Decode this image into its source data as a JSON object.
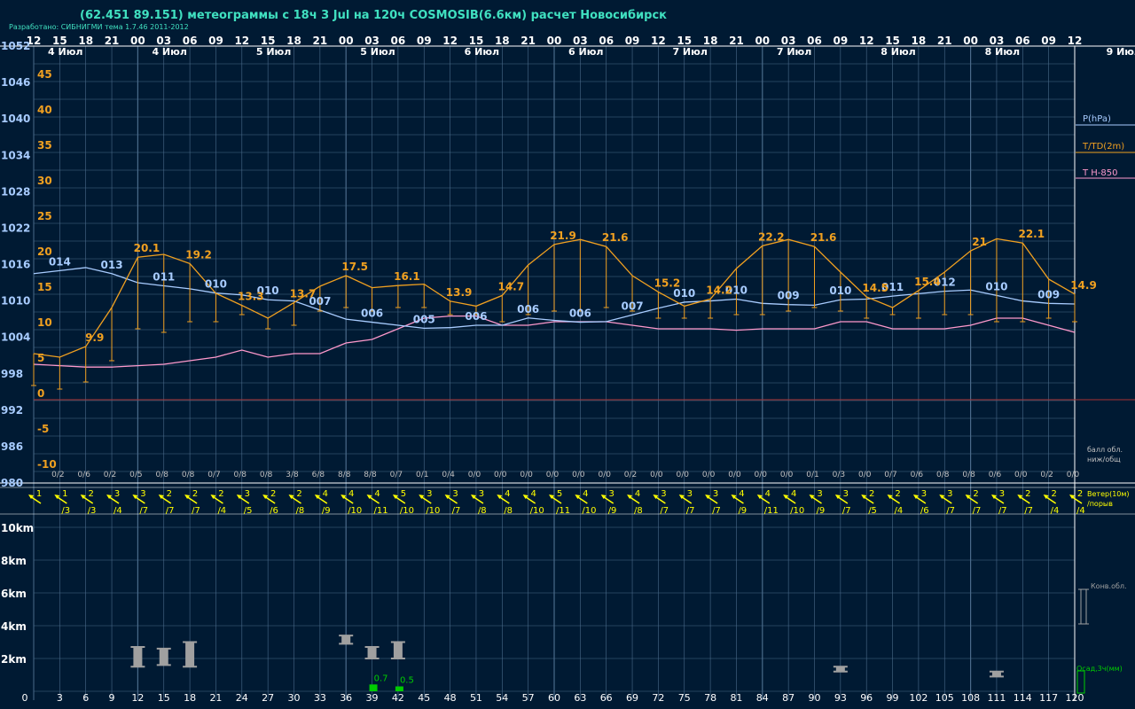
{
  "header": {
    "title": "(62.451 89.151) метеограммы с  18ч 3 Jul на 120ч COSMOSIB(6.6км) расчет Новосибирск",
    "subtitle": "Разработано: СИБНИГМИ тема 1.7.46 2011-2012"
  },
  "colors": {
    "background": "#001a33",
    "grid": "#4a6a8a",
    "pressure": "#a8ccff",
    "temperature": "#f0a020",
    "t850": "#ff99cc",
    "wind": "#ffff00",
    "precip": "#00cc00",
    "cloud": "#a0a0a0",
    "zero_line": "#aa3333",
    "hour_text": "#ffffff",
    "clouds_text": "#c0c0c0"
  },
  "legend": {
    "pressure": "P(hPa)",
    "temperature": "T/TD(2m)",
    "t850": "T H-850",
    "clouds": "балл обл.",
    "clouds2": "ниж/общ",
    "wind": "Ветер(10м)",
    "wind2": "/порыв",
    "conv": "Конв.обл.",
    "precip": "Осад,3ч(мм)"
  },
  "chart_data": {
    "type": "line",
    "time_hours": [
      0,
      3,
      6,
      9,
      12,
      15,
      18,
      21,
      24,
      27,
      30,
      33,
      36,
      39,
      42,
      45,
      48,
      51,
      54,
      57,
      60,
      63,
      66,
      69,
      72,
      75,
      78,
      81,
      84,
      87,
      90,
      93,
      96,
      99,
      102,
      105,
      108,
      111,
      114,
      117,
      120
    ],
    "hour_labels": [
      "12",
      "15",
      "18",
      "21",
      "00",
      "03",
      "06",
      "09",
      "12",
      "15",
      "18",
      "21",
      "00",
      "03",
      "06",
      "09",
      "12",
      "15",
      "18",
      "21",
      "00",
      "03",
      "06",
      "09",
      "12",
      "15",
      "18",
      "21",
      "00",
      "03",
      "06",
      "09",
      "12",
      "15",
      "18",
      "21",
      "00",
      "03",
      "06",
      "09",
      "12"
    ],
    "day_labels": [
      {
        "label": "4 Июл",
        "hour": 1
      },
      {
        "label": "4 Июл",
        "hour": 13
      },
      {
        "label": "5 Июл",
        "hour": 25
      },
      {
        "label": "5 Июл",
        "hour": 37
      },
      {
        "label": "6 Июл",
        "hour": 49
      },
      {
        "label": "6 Июл",
        "hour": 61
      },
      {
        "label": "7 Июл",
        "hour": 73
      },
      {
        "label": "7 Июл",
        "hour": 85
      },
      {
        "label": "8 Июл",
        "hour": 97
      },
      {
        "label": "8 Июл",
        "hour": 109
      },
      {
        "label": "9 Июл",
        "hour": 123
      }
    ],
    "pressure_axis": {
      "ticks": [
        "1052",
        "1046",
        "1040",
        "1034",
        "1028",
        "1022",
        "1016",
        "1010",
        "1004",
        "998",
        "992",
        "986",
        "980"
      ],
      "min": 980,
      "max": 1052
    },
    "temp_axis": {
      "ticks": [
        "45",
        "40",
        "35",
        "30",
        "25",
        "20",
        "15",
        "10",
        "5",
        "0",
        "-5",
        "-10"
      ],
      "min": -10,
      "max": 45
    },
    "pressure": [
      1014.5,
      1015,
      1015.5,
      1014.5,
      1013,
      1012.5,
      1012,
      1011.3,
      1011,
      1010.2,
      1010,
      1008.5,
      1007,
      1006.5,
      1006,
      1005.5,
      1005.6,
      1006,
      1006,
      1007.2,
      1006.8,
      1006.5,
      1006.6,
      1007.7,
      1008.8,
      1009.8,
      1010,
      1010.3,
      1009.6,
      1009.4,
      1009.3,
      1010.2,
      1010.3,
      1010.8,
      1011.2,
      1011.6,
      1011.8,
      1010.9,
      1010,
      1009.6,
      1009.5
    ],
    "temperature": [
      6.5,
      6,
      7.5,
      13,
      20.1,
      20.5,
      19.2,
      15,
      13.3,
      11.5,
      13.7,
      16,
      17.5,
      15.8,
      16.1,
      16.3,
      13.9,
      13.2,
      14.7,
      19,
      21.9,
      22.6,
      21.6,
      17.5,
      15.2,
      13.2,
      14.2,
      18.5,
      21.7,
      22.6,
      21.6,
      18,
      14.5,
      13,
      15.4,
      18,
      21,
      22.7,
      22.1,
      17,
      14.9
    ],
    "dewpoint": [
      2,
      1.5,
      2.5,
      5.5,
      10,
      9.5,
      11,
      11,
      12,
      10,
      10.5,
      12.5,
      13,
      12.5,
      13,
      13,
      12,
      12,
      11,
      12,
      12.5,
      12.5,
      13,
      12.5,
      11.5,
      11.5,
      11.5,
      12,
      12,
      12.5,
      13,
      12.5,
      11.5,
      12,
      11.5,
      12,
      12,
      11,
      11,
      11.5,
      11
    ],
    "t850": [
      5,
      4.8,
      4.6,
      4.6,
      4.8,
      5,
      5.5,
      6,
      7,
      6,
      6.5,
      6.5,
      8,
      8.5,
      10,
      11.5,
      11.8,
      11.8,
      10.5,
      10.5,
      11,
      11,
      11,
      10.5,
      10,
      10,
      10,
      9.8,
      10,
      10,
      10,
      11,
      11,
      10,
      10,
      10,
      10.5,
      11.5,
      11.5,
      10.5,
      9.5
    ],
    "labels": {
      "pressure": [
        {
          "i": 1,
          "t": "014"
        },
        {
          "i": 3,
          "t": "013"
        },
        {
          "i": 5,
          "t": "011"
        },
        {
          "i": 7,
          "t": "010"
        },
        {
          "i": 9,
          "t": "010"
        },
        {
          "i": 11,
          "t": "007"
        },
        {
          "i": 13,
          "t": "006"
        },
        {
          "i": 15,
          "t": "005"
        },
        {
          "i": 17,
          "t": "006"
        },
        {
          "i": 19,
          "t": "006"
        },
        {
          "i": 21,
          "t": "006"
        },
        {
          "i": 23,
          "t": "007"
        },
        {
          "i": 25,
          "t": "010"
        },
        {
          "i": 27,
          "t": "010"
        },
        {
          "i": 29,
          "t": "009"
        },
        {
          "i": 31,
          "t": "010"
        },
        {
          "i": 33,
          "t": "011"
        },
        {
          "i": 35,
          "t": "012"
        },
        {
          "i": 37,
          "t": "010"
        },
        {
          "i": 39,
          "t": "009"
        }
      ],
      "temperature": [
        {
          "i": 2,
          "t": "9.9"
        },
        {
          "i": 4,
          "t": "20.1"
        },
        {
          "i": 6,
          "t": "19.2"
        },
        {
          "i": 8,
          "t": "13.3"
        },
        {
          "i": 10,
          "t": "13.7"
        },
        {
          "i": 12,
          "t": "17.5"
        },
        {
          "i": 14,
          "t": "16.1"
        },
        {
          "i": 16,
          "t": "13.9"
        },
        {
          "i": 18,
          "t": "14.7"
        },
        {
          "i": 20,
          "t": "21.9"
        },
        {
          "i": 22,
          "t": "21.6"
        },
        {
          "i": 24,
          "t": "15.2"
        },
        {
          "i": 26,
          "t": "14.2"
        },
        {
          "i": 28,
          "t": "22.2"
        },
        {
          "i": 30,
          "t": "21.6"
        },
        {
          "i": 32,
          "t": "14.5"
        },
        {
          "i": 34,
          "t": "15.4"
        },
        {
          "i": 36,
          "t": "21"
        },
        {
          "i": 38,
          "t": "22.1"
        },
        {
          "i": 40,
          "t": "14.9"
        }
      ]
    },
    "clouds": [
      "0/2",
      "0/6",
      "0/2",
      "0/5",
      "0/8",
      "0/8",
      "0/7",
      "0/8",
      "0/8",
      "3/8",
      "6/8",
      "8/8",
      "8/8",
      "0/7",
      "0/1",
      "0/4",
      "0/0",
      "0/0",
      "0/0",
      "0/0",
      "0/0",
      "0/0",
      "0/2",
      "0/0",
      "0/0",
      "0/0",
      "0/0",
      "0/0",
      "0/0",
      "0/1",
      "0/3",
      "0/0",
      "0/7",
      "0/6",
      "0/8",
      "0/8",
      "0/6",
      "0/0",
      "0/2",
      "0/0"
    ],
    "wind": [
      "1",
      "1",
      "2",
      "3",
      "3",
      "2",
      "2",
      "2",
      "3",
      "2",
      "2",
      "4",
      "4",
      "4",
      "5",
      "3",
      "3",
      "3",
      "4",
      "4",
      "5",
      "4",
      "3",
      "4",
      "3",
      "3",
      "3",
      "4",
      "4",
      "4",
      "3",
      "3",
      "2",
      "2",
      "3",
      "3",
      "2",
      "3",
      "2",
      "2",
      "2"
    ],
    "gust": [
      "",
      "/3",
      "/3",
      "/4",
      "/7",
      "/7",
      "/7",
      "/4",
      "/5",
      "/6",
      "/8",
      "/9",
      "/10",
      "/11",
      "/10",
      "/10",
      "/7",
      "/8",
      "/8",
      "/10",
      "/11",
      "/10",
      "/9",
      "/8",
      "/7",
      "/7",
      "/7",
      "/9",
      "/11",
      "/10",
      "/9",
      "/7",
      "/5",
      "/4",
      "/6",
      "/7",
      "/7",
      "/7",
      "/7",
      "/4",
      "/4"
    ],
    "height_axis": [
      "10km",
      "8km",
      "6km",
      "4km",
      "2km"
    ],
    "convective_clouds": [
      {
        "hour": 12,
        "base": 1.5,
        "top": 2.7
      },
      {
        "hour": 15,
        "base": 1.6,
        "top": 2.6
      },
      {
        "hour": 18,
        "base": 1.5,
        "top": 3.0
      },
      {
        "hour": 36,
        "base": 2.9,
        "top": 3.4
      },
      {
        "hour": 39,
        "base": 2.0,
        "top": 2.7
      },
      {
        "hour": 42,
        "base": 2.0,
        "top": 3.0
      },
      {
        "hour": 93,
        "base": 1.2,
        "top": 1.5
      },
      {
        "hour": 111,
        "base": 0.9,
        "top": 1.2
      }
    ],
    "precipitation": [
      {
        "hour": 39,
        "value": 0.7,
        "t": "0.7"
      },
      {
        "hour": 42,
        "value": 0.5,
        "t": "0.5"
      }
    ]
  }
}
